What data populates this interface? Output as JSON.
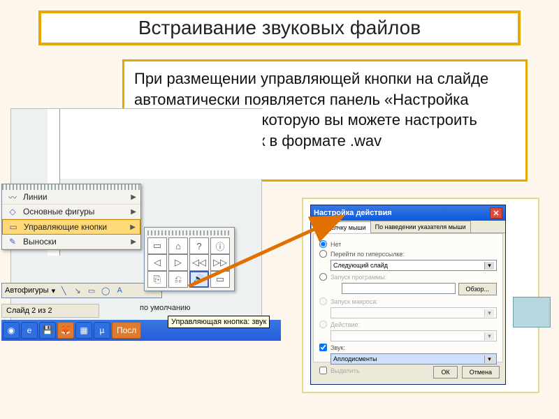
{
  "title": "Встраивание звуковых файлов",
  "body_text": "При размещении управляющей кнопки на слайде автоматически появляется панель «Настройка действия», через которую вы можете настроить необходимый звук в формате .wav",
  "menu": {
    "items": [
      {
        "icon": "〰",
        "label": "Линии"
      },
      {
        "icon": "◇",
        "label": "Основные фигуры"
      },
      {
        "icon": "▭",
        "label": "Управляющие кнопки",
        "selected": true
      },
      {
        "icon": "✎",
        "label": "Выноски"
      }
    ]
  },
  "autoshapes_label": "Автофигуры",
  "slide_status": "Слайд 2 из 2",
  "default_label": "по умолчанию",
  "tooltip": "Управляющая кнопка: звук",
  "taskbar_running": "Посл",
  "button_grid": [
    [
      "▭",
      "⌂",
      "?",
      "ⓘ"
    ],
    [
      "◁",
      "▷",
      "◁◁",
      "▷▷"
    ],
    [
      "⎘",
      "⎌",
      "🔊",
      "▭"
    ]
  ],
  "button_grid_highlight": [
    2,
    2
  ],
  "dialog": {
    "title": "Настройка действия",
    "tabs": [
      "По щелчку мыши",
      "По наведении указателя мыши"
    ],
    "active_tab": 0,
    "options": {
      "none": "Нет",
      "hyperlink": "Перейти по гиперссылке:",
      "hyperlink_value": "Следующий слайд",
      "run_program": "Запуск программы:",
      "browse": "Обзор...",
      "run_macro": "Запуск макроса:",
      "action": "Действие:",
      "sound_chk": "Звук:",
      "sound_value": "Аплодисменты",
      "highlight_chk": "Выделить"
    },
    "buttons": {
      "ok": "ОК",
      "cancel": "Отмена"
    }
  }
}
